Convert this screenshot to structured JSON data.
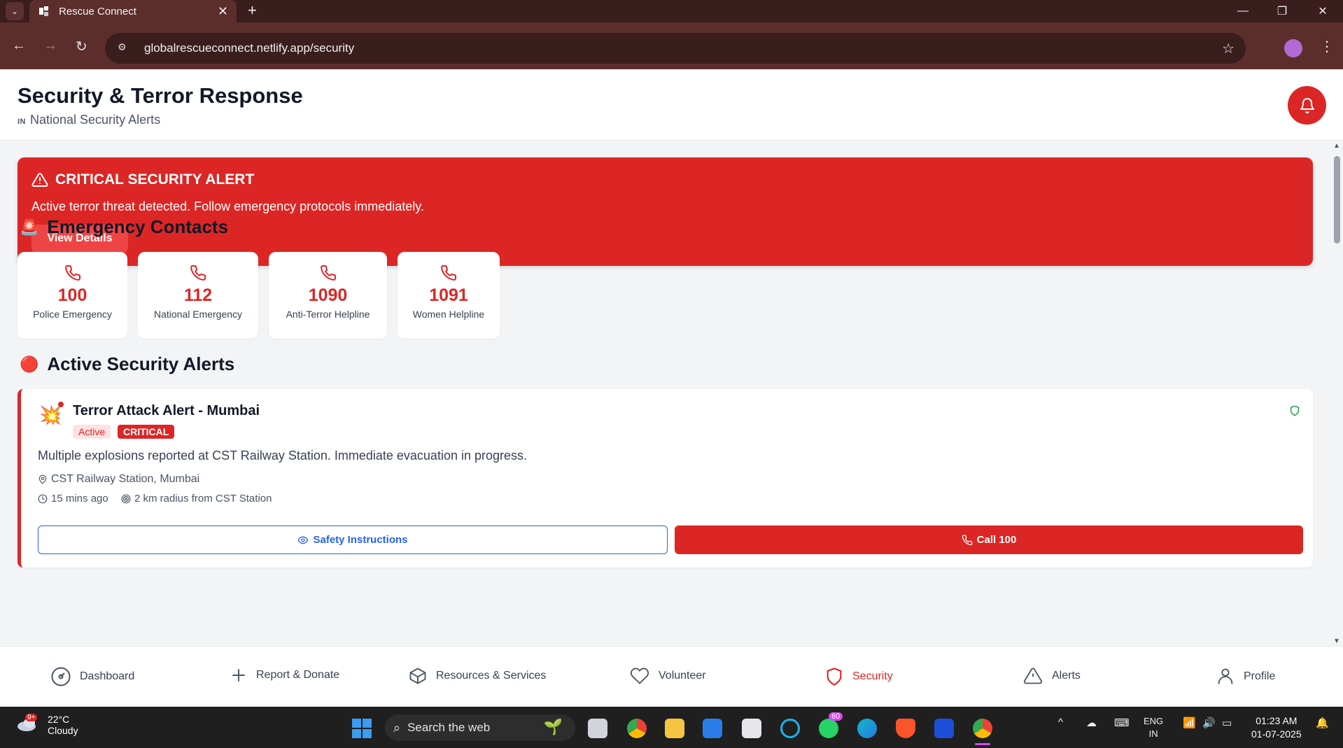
{
  "browser": {
    "tab_title": "Rescue Connect",
    "url": "globalrescueconnect.netlify.app/security",
    "new_tab_symbol": "+",
    "close_tab_symbol": "✕"
  },
  "header": {
    "title": "Security & Terror Response",
    "region_code": "IN",
    "region_name": "National Security Alerts"
  },
  "banner": {
    "title": "CRITICAL SECURITY ALERT",
    "message": "Active terror threat detected. Follow emergency protocols immediately.",
    "button_label": "View Details"
  },
  "emergency": {
    "section_title": "Emergency Contacts",
    "section_icon": "🚨",
    "contacts": [
      {
        "number": "100",
        "label": "Police Emergency"
      },
      {
        "number": "112",
        "label": "National Emergency"
      },
      {
        "number": "1090",
        "label": "Anti-Terror Helpline"
      },
      {
        "number": "1091",
        "label": "Women Helpline"
      }
    ]
  },
  "alerts": {
    "section_title": "Active Security Alerts",
    "section_icon": "🔴",
    "items": [
      {
        "icon": "💥",
        "title": "Terror Attack Alert - Mumbai",
        "status": "Active",
        "severity": "CRITICAL",
        "description": "Multiple explosions reported at CST Railway Station. Immediate evacuation in progress.",
        "location": "CST Railway Station, Mumbai",
        "time": "15 mins ago",
        "radius": "2 km radius from CST Station",
        "primary_action": "Safety Instructions",
        "call_action": "Call 100"
      }
    ]
  },
  "bottom_nav": [
    {
      "label": "Dashboard",
      "icon": "dashboard-icon"
    },
    {
      "label": "Report & Donate",
      "icon": "plus-icon"
    },
    {
      "label": "Resources & Services",
      "icon": "box-icon"
    },
    {
      "label": "Volunteer",
      "icon": "heart-icon"
    },
    {
      "label": "Security",
      "icon": "shield-icon",
      "active": true
    },
    {
      "label": "Alerts",
      "icon": "warning-icon"
    },
    {
      "label": "Profile",
      "icon": "user-icon"
    }
  ],
  "taskbar": {
    "weather_temp": "22°C",
    "weather_desc": "Cloudy",
    "weather_badge": "9+",
    "search_placeholder": "Search the web",
    "whatsapp_badge": "60",
    "language": "ENG",
    "language_region": "IN",
    "time": "01:23 AM",
    "date": "01-07-2025"
  },
  "colors": {
    "accent_red": "#dc2626",
    "link_blue": "#2563eb",
    "chrome_bg": "#5b2e2c"
  }
}
